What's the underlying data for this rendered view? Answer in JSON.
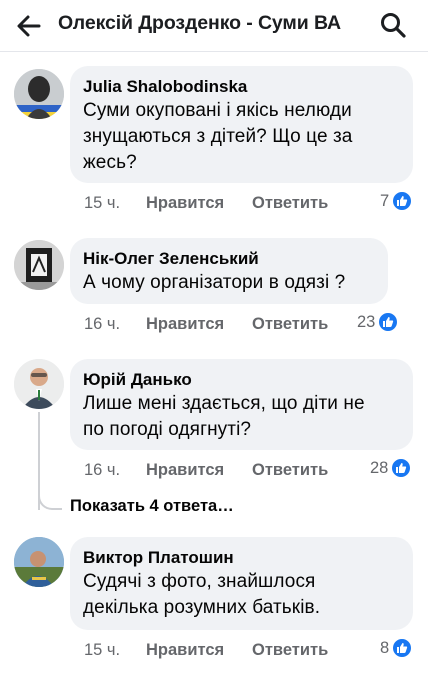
{
  "header": {
    "title": "Олексій Дрозденко - Суми ВА",
    "back_icon": "arrow-left-icon",
    "search_icon": "search-icon"
  },
  "like_badge_color": "#1877f2",
  "comments": [
    {
      "author": "Julia Shalobodinska",
      "text_lines": [
        "Суми окуповані і якісь нелюди",
        "знущаються з дітей? Що це за",
        "жесь?"
      ],
      "time": "15 ч.",
      "like_label": "Нравится",
      "reply_label": "Ответить",
      "reactions": "7"
    },
    {
      "author": "Нік-Олег Зеленський",
      "text_lines": [
        "А чому організатори в одязі ?"
      ],
      "time": "16 ч.",
      "like_label": "Нравится",
      "reply_label": "Ответить",
      "reactions": "23"
    },
    {
      "author": "Юрій Данько",
      "text_lines": [
        "Лише мені здається, що діти не",
        "по погоді одягнуті?"
      ],
      "time": "16 ч.",
      "like_label": "Нравится",
      "reply_label": "Ответить",
      "reactions": "28"
    },
    {
      "author": "Виктор Платошин",
      "text_lines": [
        "Судячі з фото, знайшлося",
        "декілька розумних батьків."
      ],
      "time": "15 ч.",
      "like_label": "Нравится",
      "reply_label": "Ответить",
      "reactions": "8"
    }
  ],
  "show_more_replies": "Показать 4 ответа…"
}
